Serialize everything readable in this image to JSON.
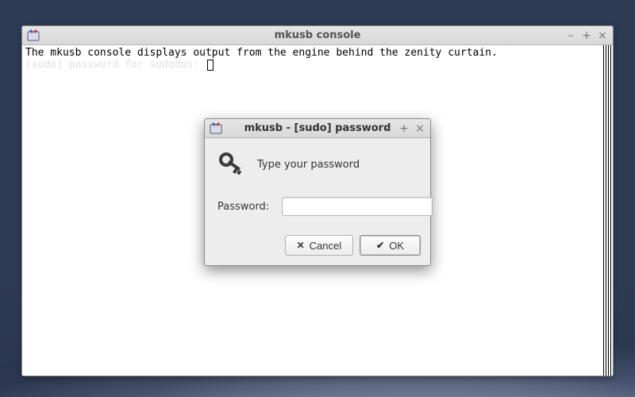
{
  "console_window": {
    "title": "mkusb console",
    "line1": "The mkusb console displays output from the engine behind the zenity curtain.",
    "line2_faint": "[sudo] password for sudodus:"
  },
  "dialog": {
    "title": "mkusb - [sudo] password",
    "prompt": "Type your password",
    "password_label": "Password:",
    "password_value": "",
    "password_placeholder": "",
    "cancel_label": "Cancel",
    "ok_label": "OK"
  },
  "icons": {
    "minimize": "–",
    "maximize": "+",
    "close": "×",
    "cancel_glyph": "✕",
    "ok_glyph": "✔"
  },
  "colors": {
    "desktop_base": "#2e3b55",
    "panel_bg": "#ededed",
    "titlebar_bg": "#e0e0e0"
  }
}
